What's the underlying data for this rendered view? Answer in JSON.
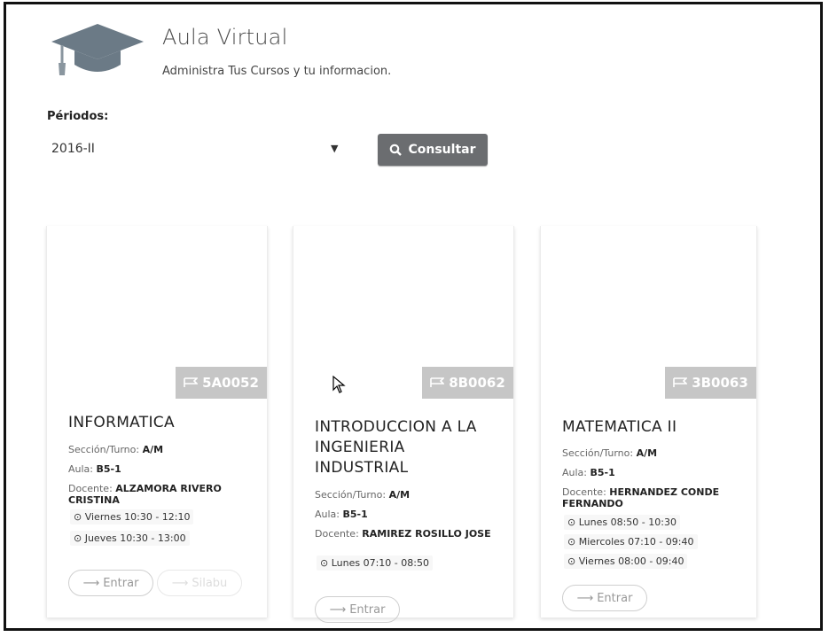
{
  "app": {
    "title": "Aula Virtual",
    "subtitle": "Administra Tus Cursos y tu informacion."
  },
  "filter": {
    "label": "Périodos:",
    "selected": "2016-II",
    "button_label": "Consultar",
    "button_icon": "search-icon"
  },
  "labels": {
    "section": "Sección/Turno: ",
    "room": "Aula: ",
    "teacher": "Docente: ",
    "enter": "Entrar",
    "syllabus": "Silabu"
  },
  "courses": [
    {
      "code": "5A0052",
      "title": "INFORMATICA",
      "section": "A/M",
      "room": "B5-1",
      "teacher": "ALZAMORA RIVERO CRISTINA",
      "schedule": [
        "Viernes 10:30 - 12:10",
        "Jueves 10:30 - 13:00"
      ]
    },
    {
      "code": "8B0062",
      "title": "INTRODUCCION A LA INGENIERIA INDUSTRIAL",
      "section": "A/M",
      "room": "B5-1",
      "teacher": "RAMIREZ ROSILLO JOSE",
      "schedule": [
        "Lunes 07:10 - 08:50"
      ]
    },
    {
      "code": "3B0063",
      "title": "MATEMATICA II",
      "section": "A/M",
      "room": "B5-1",
      "teacher": "HERNANDEZ CONDE FERNANDO",
      "schedule": [
        "Lunes 08:50 - 10:30",
        "Miercoles 07:10 - 09:40",
        "Viernes 08:00 - 09:40"
      ]
    }
  ],
  "colors": {
    "button": "#6b6d70",
    "tag": "#c6c6c6"
  }
}
